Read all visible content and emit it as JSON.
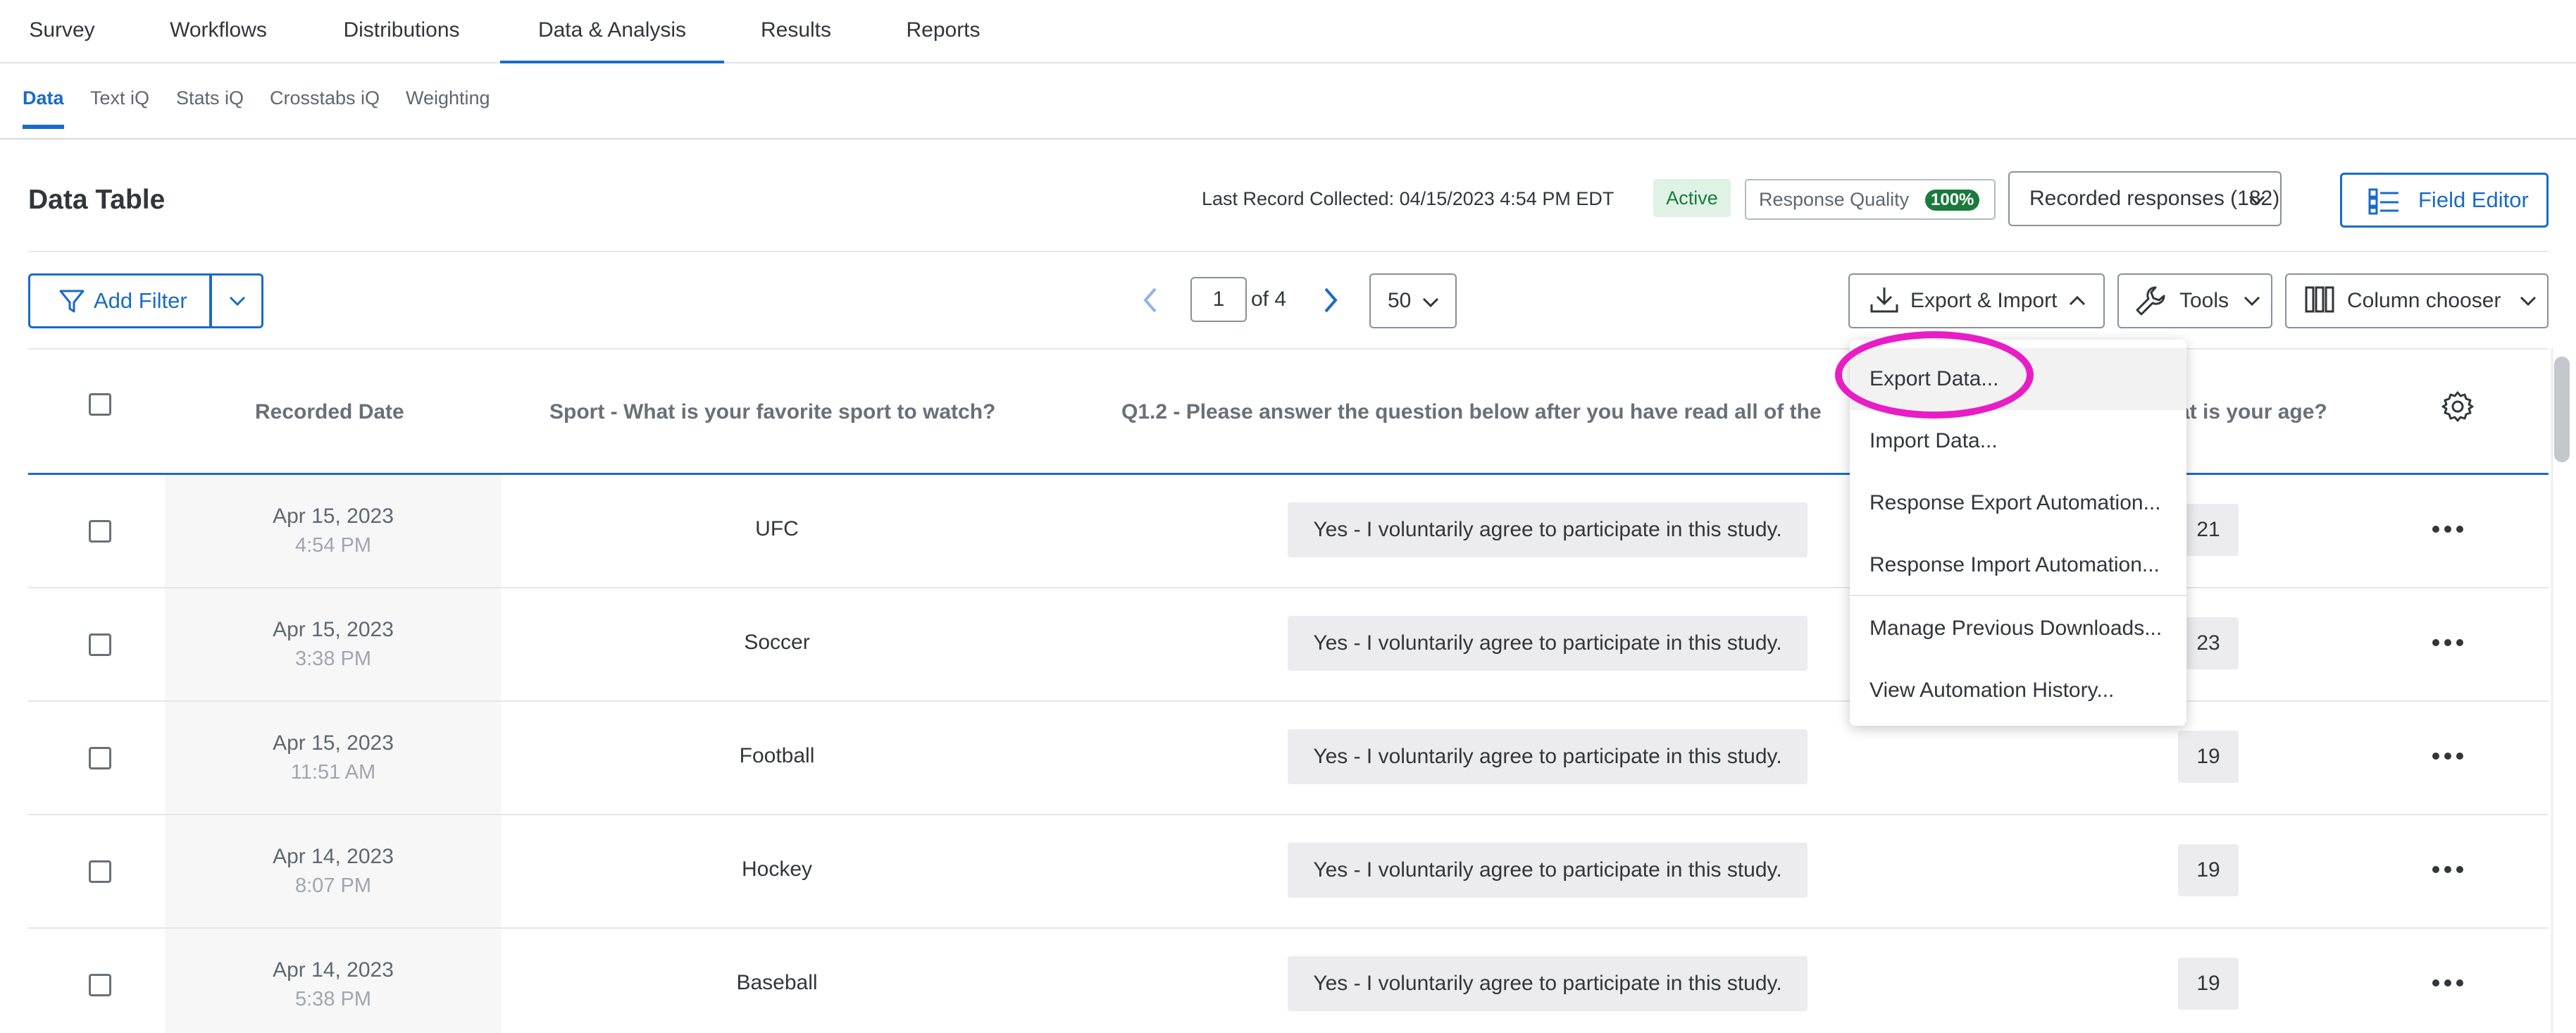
{
  "topnav": {
    "tabs": [
      {
        "label": "Survey"
      },
      {
        "label": "Workflows"
      },
      {
        "label": "Distributions"
      },
      {
        "label": "Data & Analysis"
      },
      {
        "label": "Results"
      },
      {
        "label": "Reports"
      }
    ],
    "active_tab": "Data & Analysis"
  },
  "subnav": {
    "tabs": [
      {
        "label": "Data"
      },
      {
        "label": "Text iQ"
      },
      {
        "label": "Stats iQ"
      },
      {
        "label": "Crosstabs iQ"
      },
      {
        "label": "Weighting"
      }
    ],
    "active_tab": "Data"
  },
  "header": {
    "title": "Data Table",
    "last_record": "Last Record Collected: 04/15/2023 4:54 PM EDT",
    "status_badge": "Active",
    "response_quality_label": "Response Quality",
    "response_quality_value": "100%",
    "recorded_responses": "Recorded responses (182)",
    "field_editor": "Field Editor"
  },
  "toolbar": {
    "add_filter": "Add Filter",
    "page_current": "1",
    "page_of": "of 4",
    "per_page": "50",
    "export_import": "Export & Import",
    "tools": "Tools",
    "column_chooser": "Column chooser"
  },
  "table": {
    "columns": [
      "Recorded Date",
      "Sport - What is your favorite sport to watch?",
      "Q1.2 - Please answer the question below after you have read all of the",
      "at is your age?"
    ],
    "rows": [
      {
        "date": "Apr 15, 2023",
        "time": "4:54 PM",
        "sport": "UFC",
        "consent": "Yes - I voluntarily agree to participate in this study.",
        "age": "21"
      },
      {
        "date": "Apr 15, 2023",
        "time": "3:38 PM",
        "sport": "Soccer",
        "consent": "Yes - I voluntarily agree to participate in this study.",
        "age": "23"
      },
      {
        "date": "Apr 15, 2023",
        "time": "11:51 AM",
        "sport": "Football",
        "consent": "Yes - I voluntarily agree to participate in this study.",
        "age": "19"
      },
      {
        "date": "Apr 14, 2023",
        "time": "8:07 PM",
        "sport": "Hockey",
        "consent": "Yes - I voluntarily agree to participate in this study.",
        "age": "19"
      },
      {
        "date": "Apr 14, 2023",
        "time": "5:38 PM",
        "sport": "Baseball",
        "consent": "Yes - I voluntarily agree to participate in this study.",
        "age": "19"
      }
    ]
  },
  "export_menu": {
    "items": [
      {
        "label": "Export Data..."
      },
      {
        "label": "Import Data..."
      },
      {
        "label": "Response Export Automation..."
      },
      {
        "label": "Response Import Automation..."
      },
      {
        "label": "Manage Previous Downloads..."
      },
      {
        "label": "View Automation History..."
      }
    ],
    "highlighted": "Export Data..."
  },
  "colors": {
    "accent": "#1a6bc7",
    "annotation_circle": "#e81dc5",
    "active_badge_bg": "#e0f2e6",
    "quality_pill": "#1a7a3c"
  },
  "icons": [
    "filter-icon",
    "chevron-down-icon",
    "chevron-left-icon",
    "chevron-right-icon",
    "download-icon",
    "chevron-up-icon",
    "wrench-icon",
    "columns-icon",
    "field-editor-icon",
    "gear-icon",
    "more-horizontal-icon"
  ]
}
